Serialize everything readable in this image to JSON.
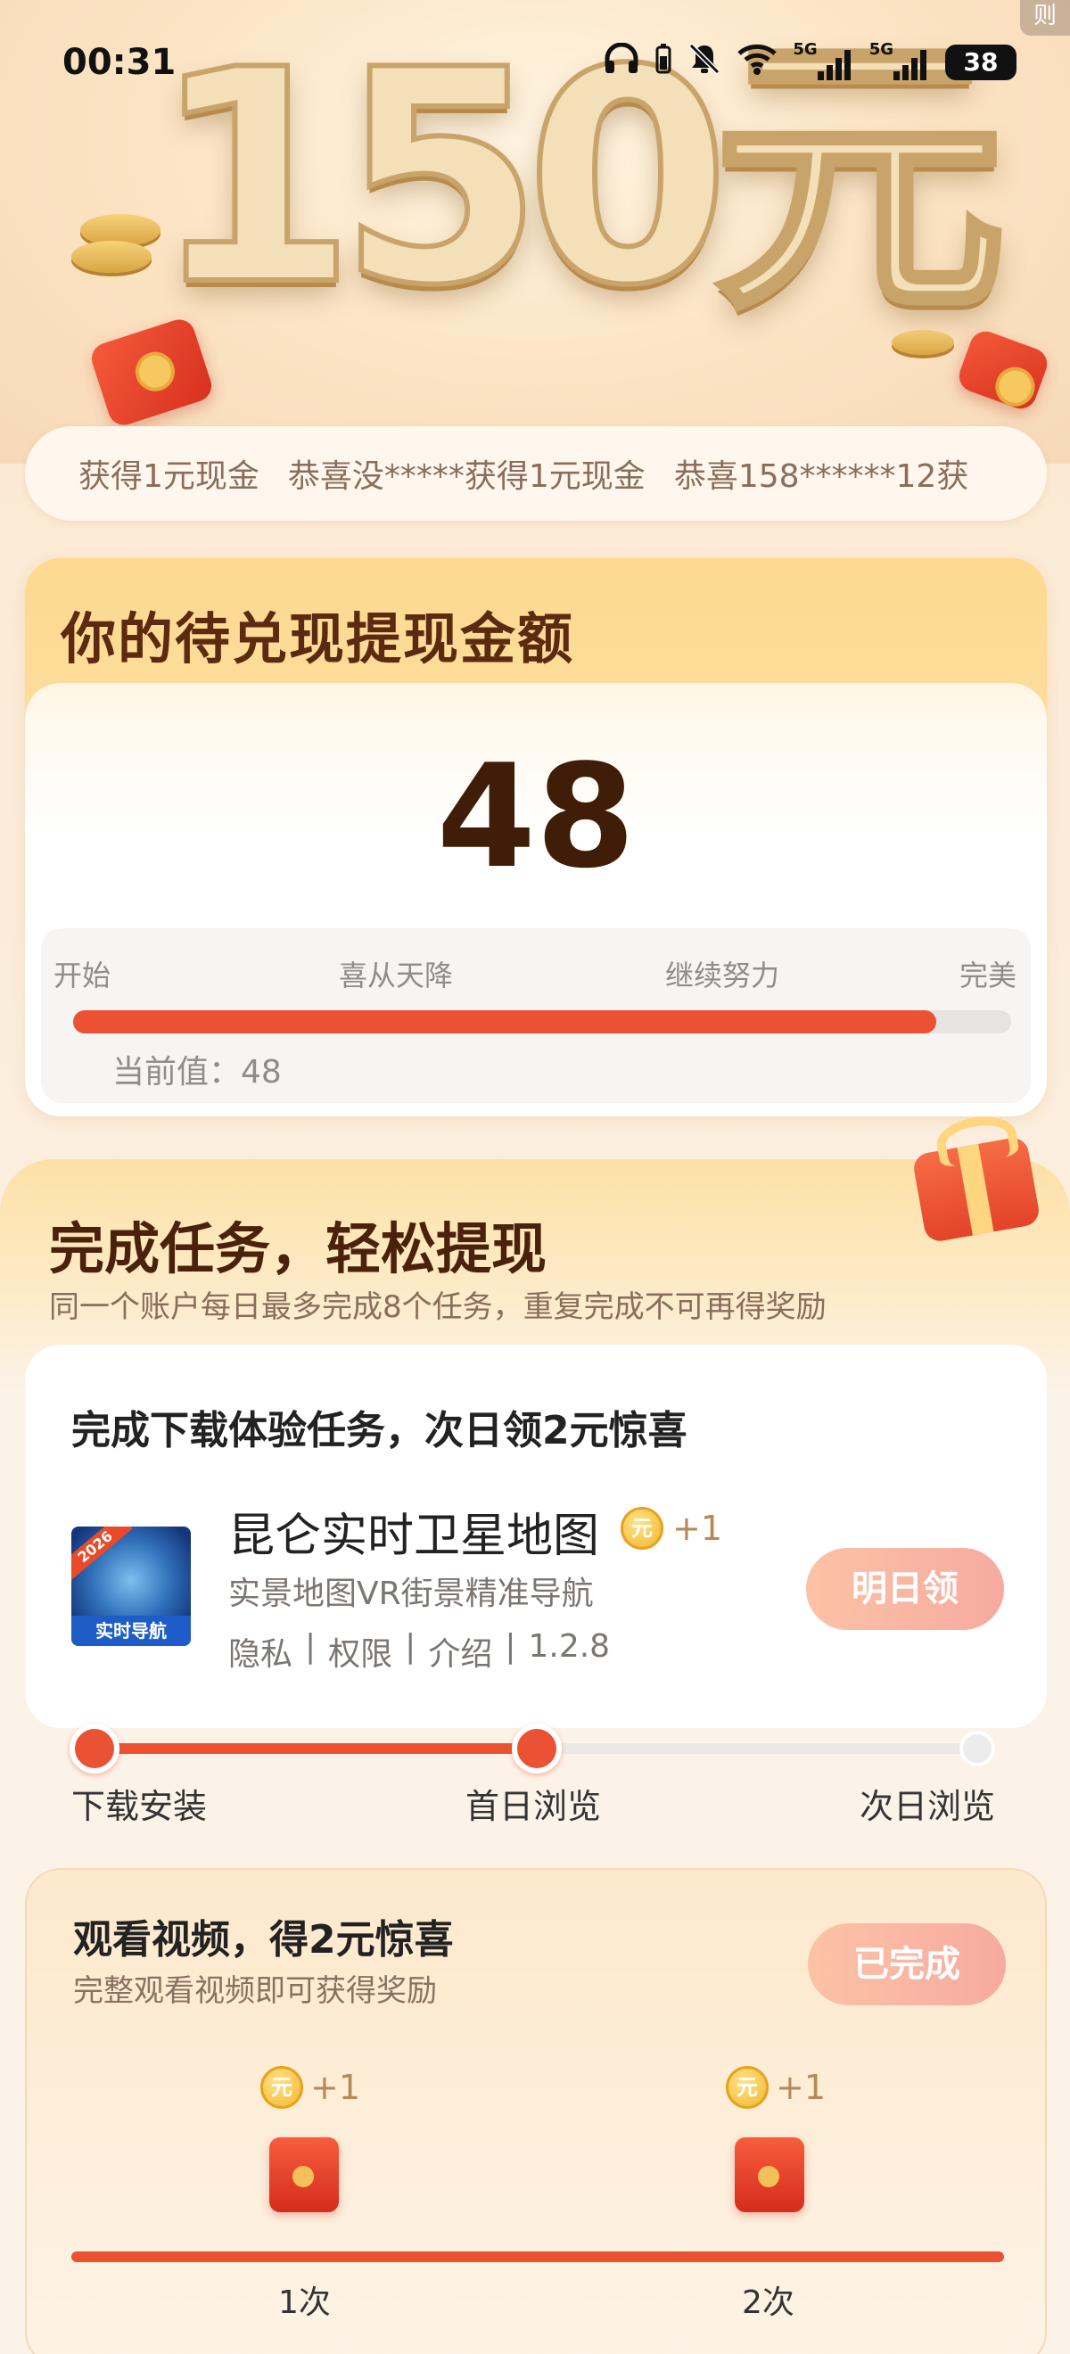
{
  "status_bar": {
    "time": "00:31",
    "icons": [
      "headphones-icon",
      "battery-small-icon",
      "mute-icon",
      "wifi-icon",
      "signal-5g-icon",
      "signal-5g-icon-2"
    ],
    "sig1_label": "5G",
    "sig2_label": "5G",
    "battery": "38"
  },
  "hero": {
    "title": "150元",
    "rule_tab": "则"
  },
  "ticker": {
    "items": [
      "获得1元现金",
      "恭喜没*****获得1元现金",
      "恭喜158******12获"
    ]
  },
  "balance": {
    "title": "你的待兑现提现金额",
    "amount": "48",
    "milestones": [
      "开始",
      "喜从天降",
      "继续努力",
      "完美"
    ],
    "progress": 0.92,
    "current_label": "当前值：48"
  },
  "tasks": {
    "title": "完成任务，轻松提现",
    "subtitle": "同一个账户每日最多完成8个任务，重复完成不可再得奖励",
    "download": {
      "heading": "完成下载体验任务，次日领2元惊喜",
      "app_name": "昆仑实时卫星地图",
      "coin": "元",
      "reward": "+1",
      "app_desc": "实景地图VR街景精准导航",
      "links": [
        "隐私",
        "权限",
        "介绍"
      ],
      "sep": "|",
      "version": "1.2.8",
      "icon_badge": "实时导航",
      "icon_ribbon": "2026",
      "button": "明日领",
      "steps": [
        "下载安装",
        "首日浏览",
        "次日浏览"
      ],
      "steps_progress": 0.5
    },
    "video": {
      "title": "观看视频，得2元惊喜",
      "subtitle": "完整观看视频即可获得奖励",
      "button": "已完成",
      "coin": "元",
      "rewards": [
        "+1",
        "+1"
      ],
      "labels": [
        "1次",
        "2次"
      ]
    }
  },
  "colors": {
    "accent": "#ea5233",
    "title_brown": "#5c2a10",
    "muted": "#8f8c8a"
  }
}
